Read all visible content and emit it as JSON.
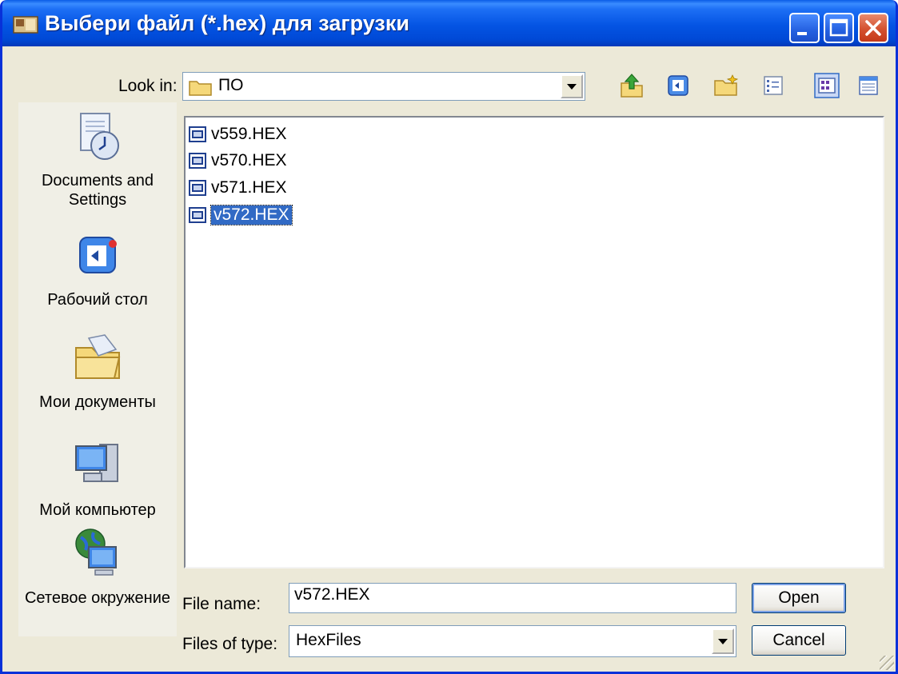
{
  "window": {
    "title": "Выбери файл (*.hex) для загрузки"
  },
  "lookin": {
    "label": "Look in:",
    "value": "ПО"
  },
  "toolbar": {
    "icons": [
      "up-folder-icon",
      "desktop-icon",
      "new-folder-icon",
      "view-details-icon",
      "view-list-icon",
      "view-menu-icon"
    ]
  },
  "places": [
    {
      "label": "Documents and Settings",
      "icon": "recent-documents-icon"
    },
    {
      "label": "Рабочий стол",
      "icon": "desktop-icon"
    },
    {
      "label": "Мои документы",
      "icon": "my-documents-icon"
    },
    {
      "label": "Мой компьютер",
      "icon": "my-computer-icon"
    },
    {
      "label": "Сетевое окружение",
      "icon": "network-icon"
    }
  ],
  "files": [
    {
      "name": "v559.HEX",
      "selected": false
    },
    {
      "name": "v570.HEX",
      "selected": false
    },
    {
      "name": "v571.HEX",
      "selected": false
    },
    {
      "name": "v572.HEX",
      "selected": true
    }
  ],
  "filename": {
    "label": "File name:",
    "value": "v572.HEX"
  },
  "filetype": {
    "label": "Files of type:",
    "value": "HexFiles"
  },
  "buttons": {
    "open": "Open",
    "cancel": "Cancel"
  },
  "colors": {
    "titlebar": "#0054e3",
    "selection": "#316ac5",
    "dialog": "#ece9d8"
  }
}
